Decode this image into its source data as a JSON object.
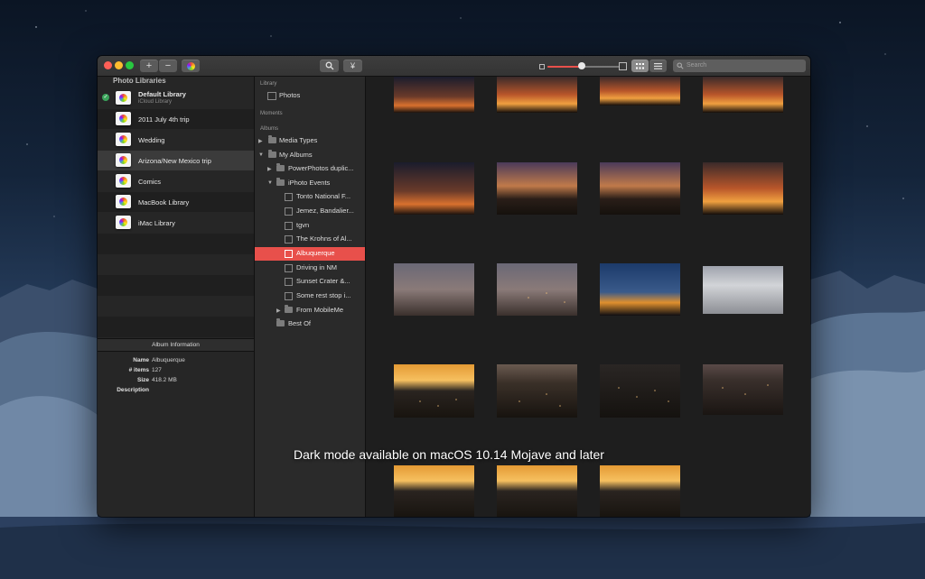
{
  "caption": "Dark mode available on macOS 10.14 Mojave and later",
  "toolbar": {
    "add_label": "+",
    "remove_label": "−",
    "search_placeholder": "Search"
  },
  "photo_libraries": {
    "header": "Photo Libraries",
    "items": [
      {
        "label": "Default Library",
        "sublabel": "iCloud Library",
        "selected_default": true
      },
      {
        "label": "2011 July 4th trip"
      },
      {
        "label": "Wedding"
      },
      {
        "label": "Arizona/New Mexico trip",
        "highlighted": true
      },
      {
        "label": "Comics"
      },
      {
        "label": "MacBook Library"
      },
      {
        "label": "iMac Library"
      }
    ]
  },
  "album_info": {
    "header": "Album Information",
    "name_key": "Name",
    "name_val": "Albuquerque",
    "items_key": "# items",
    "items_val": "127",
    "size_key": "Size",
    "size_val": "418.2 MB",
    "desc_key": "Description"
  },
  "source_list": {
    "library_section": "Library",
    "photos": "Photos",
    "moments_section": "Moments",
    "albums_section": "Albums",
    "media_types": "Media Types",
    "my_albums": "My Albums",
    "powerphotos": "PowerPhotos duplic...",
    "iphoto_events": "iPhoto Events",
    "events": [
      "Tonto National F...",
      "Jemez, Bandalier...",
      "tgvn",
      "The Krohns of Al...",
      "Albuquerque",
      "Driving in NM",
      "Sunset Crater &...",
      "Some rest stop i..."
    ],
    "from_mobileme": "From MobileMe",
    "best_of": "Best Of",
    "selected": "Albuquerque"
  },
  "colors": {
    "selection": "#e8504b",
    "accent_slider": "#e8504b"
  },
  "icons": [
    "search-icon",
    "yen-icon",
    "grid-view-icon",
    "list-view-icon",
    "folder-icon",
    "checkmark-icon"
  ]
}
